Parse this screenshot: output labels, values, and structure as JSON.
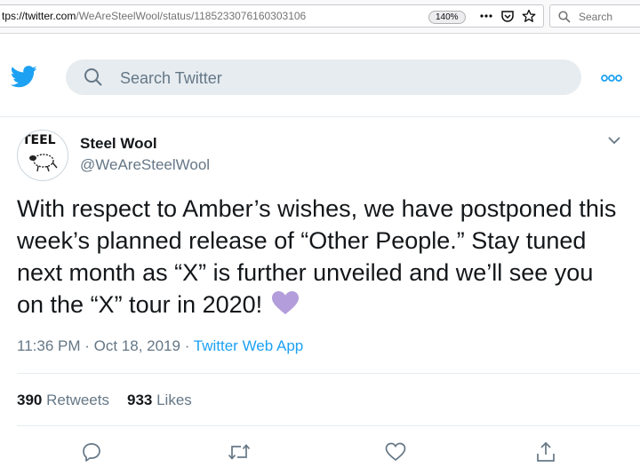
{
  "browser": {
    "url_host": "tps://twitter.com",
    "url_path": "/WeAreSteelWool/status/1185233076160303106",
    "zoom": "140%",
    "search_placeholder": "Search"
  },
  "twitter": {
    "search_placeholder": "Search Twitter"
  },
  "tweet": {
    "display_name": "Steel Wool",
    "handle": "@WeAreSteelWool",
    "avatar_text": "TEEL",
    "text": "With respect to Amber’s wishes, we have postponed this week’s planned release of “Other People.”  Stay tuned next month as “X” is further unveiled and we’ll see you on the “X” tour in 2020!",
    "emoji": "purple-heart",
    "time": "11:36 PM",
    "date": "Oct 18, 2019",
    "source": "Twitter Web App",
    "retweets_count": "390",
    "retweets_label": "Retweets",
    "likes_count": "933",
    "likes_label": "Likes"
  },
  "colors": {
    "twitter_blue": "#1da1f2",
    "secondary_text": "#657786",
    "search_bg": "#e6ecf0",
    "heart": "#b39ddb"
  }
}
